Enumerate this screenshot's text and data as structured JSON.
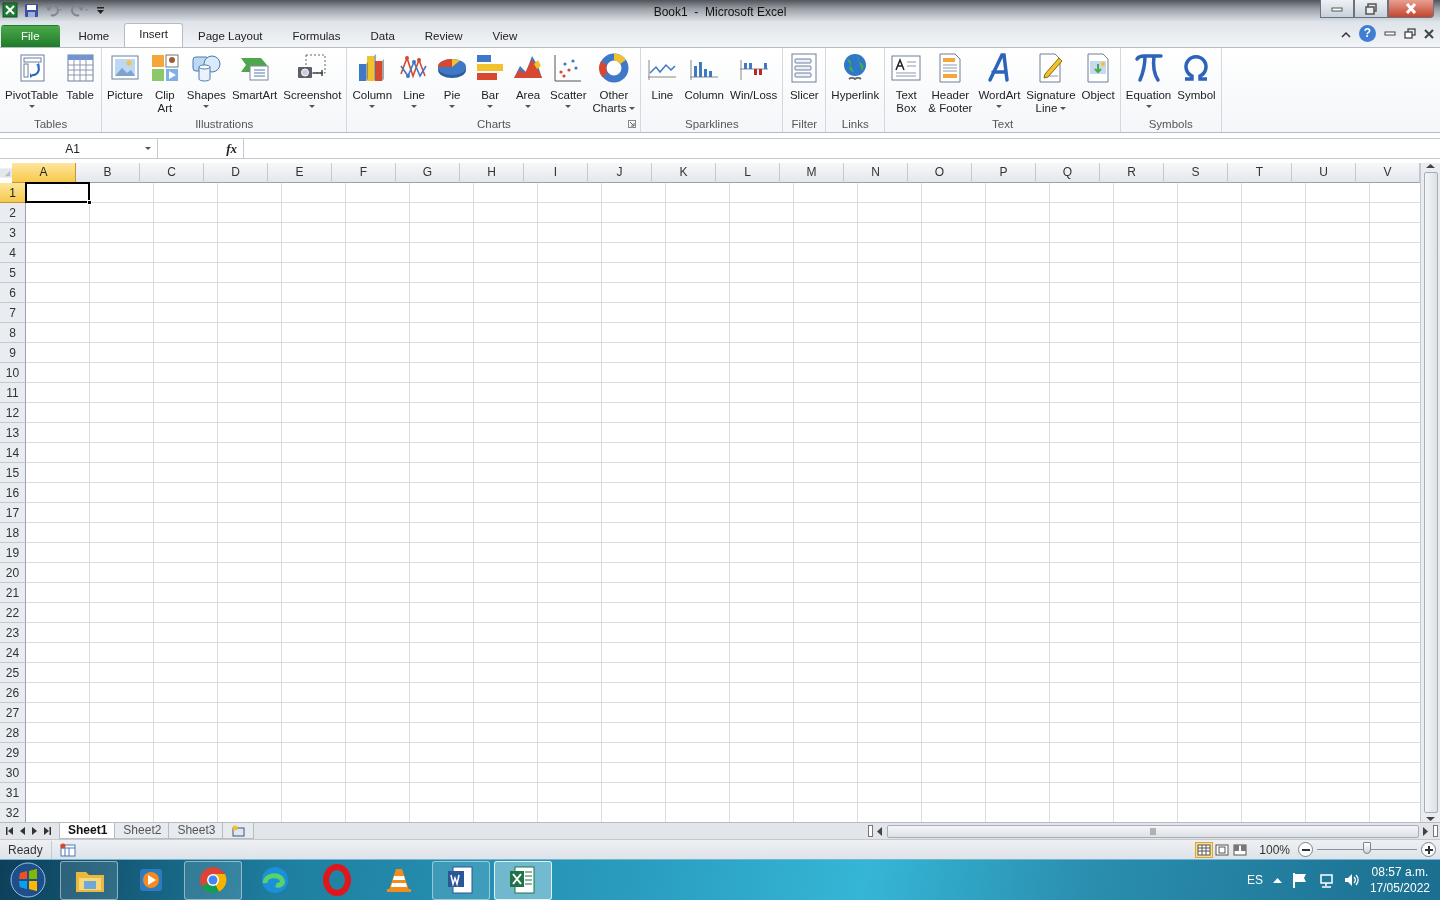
{
  "window": {
    "title": "Book1  -  Microsoft Excel"
  },
  "ribbon_tabs": [
    {
      "label": "File",
      "kind": "file",
      "selected": false
    },
    {
      "label": "Home",
      "kind": "tab",
      "selected": false
    },
    {
      "label": "Insert",
      "kind": "tab",
      "selected": true
    },
    {
      "label": "Page Layout",
      "kind": "tab",
      "selected": false
    },
    {
      "label": "Formulas",
      "kind": "tab",
      "selected": false
    },
    {
      "label": "Data",
      "kind": "tab",
      "selected": false
    },
    {
      "label": "Review",
      "kind": "tab",
      "selected": false
    },
    {
      "label": "View",
      "kind": "tab",
      "selected": false
    }
  ],
  "help": "?",
  "ribbon_groups": [
    {
      "label": "Tables",
      "buttons": [
        {
          "label": "PivotTable",
          "dropdown": true
        },
        {
          "label": "Table"
        }
      ]
    },
    {
      "label": "Illustrations",
      "buttons": [
        {
          "label": "Picture"
        },
        {
          "label": "Clip\nArt"
        },
        {
          "label": "Shapes",
          "dropdown": true
        },
        {
          "label": "SmartArt"
        },
        {
          "label": "Screenshot",
          "dropdown": true
        }
      ]
    },
    {
      "label": "Charts",
      "launcher": true,
      "buttons": [
        {
          "label": "Column",
          "dropdown": true
        },
        {
          "label": "Line",
          "dropdown": true
        },
        {
          "label": "Pie",
          "dropdown": true
        },
        {
          "label": "Bar",
          "dropdown": true
        },
        {
          "label": "Area",
          "dropdown": true
        },
        {
          "label": "Scatter",
          "dropdown": true
        },
        {
          "label": "Other\nCharts",
          "dropdown": true,
          "arrow_inline": true
        }
      ]
    },
    {
      "label": "Sparklines",
      "buttons": [
        {
          "label": "Line"
        },
        {
          "label": "Column"
        },
        {
          "label": "Win/Loss"
        }
      ]
    },
    {
      "label": "Filter",
      "buttons": [
        {
          "label": "Slicer"
        }
      ]
    },
    {
      "label": "Links",
      "buttons": [
        {
          "label": "Hyperlink"
        }
      ]
    },
    {
      "label": "Text",
      "buttons": [
        {
          "label": "Text\nBox"
        },
        {
          "label": "Header\n& Footer"
        },
        {
          "label": "WordArt",
          "dropdown": true
        },
        {
          "label": "Signature\nLine",
          "dropdown": true,
          "arrow_inline": true
        },
        {
          "label": "Object"
        }
      ]
    },
    {
      "label": "Symbols",
      "buttons": [
        {
          "label": "Equation",
          "dropdown": true
        },
        {
          "label": "Symbol"
        }
      ]
    }
  ],
  "formula_bar": {
    "name_box": "A1",
    "fx": "fx"
  },
  "columns": [
    {
      "label": "A",
      "selected": true
    },
    {
      "label": "B",
      "selected": false
    },
    {
      "label": "C",
      "selected": false
    },
    {
      "label": "D",
      "selected": false
    },
    {
      "label": "E",
      "selected": false
    },
    {
      "label": "F",
      "selected": false
    },
    {
      "label": "G",
      "selected": false
    },
    {
      "label": "H",
      "selected": false
    },
    {
      "label": "I",
      "selected": false
    },
    {
      "label": "J",
      "selected": false
    },
    {
      "label": "K",
      "selected": false
    },
    {
      "label": "L",
      "selected": false
    },
    {
      "label": "M",
      "selected": false
    },
    {
      "label": "N",
      "selected": false
    },
    {
      "label": "O",
      "selected": false
    },
    {
      "label": "P",
      "selected": false
    },
    {
      "label": "Q",
      "selected": false
    },
    {
      "label": "R",
      "selected": false
    },
    {
      "label": "S",
      "selected": false
    },
    {
      "label": "T",
      "selected": false
    },
    {
      "label": "U",
      "selected": false
    },
    {
      "label": "V",
      "selected": false
    }
  ],
  "rows": [
    {
      "label": "1",
      "selected": true
    },
    {
      "label": "2",
      "selected": false
    },
    {
      "label": "3",
      "selected": false
    },
    {
      "label": "4",
      "selected": false
    },
    {
      "label": "5",
      "selected": false
    },
    {
      "label": "6",
      "selected": false
    },
    {
      "label": "7",
      "selected": false
    },
    {
      "label": "8",
      "selected": false
    },
    {
      "label": "9",
      "selected": false
    },
    {
      "label": "10",
      "selected": false
    },
    {
      "label": "11",
      "selected": false
    },
    {
      "label": "12",
      "selected": false
    },
    {
      "label": "13",
      "selected": false
    },
    {
      "label": "14",
      "selected": false
    },
    {
      "label": "15",
      "selected": false
    },
    {
      "label": "16",
      "selected": false
    },
    {
      "label": "17",
      "selected": false
    },
    {
      "label": "18",
      "selected": false
    },
    {
      "label": "19",
      "selected": false
    },
    {
      "label": "20",
      "selected": false
    },
    {
      "label": "21",
      "selected": false
    },
    {
      "label": "22",
      "selected": false
    },
    {
      "label": "23",
      "selected": false
    },
    {
      "label": "24",
      "selected": false
    },
    {
      "label": "25",
      "selected": false
    },
    {
      "label": "26",
      "selected": false
    },
    {
      "label": "27",
      "selected": false
    },
    {
      "label": "28",
      "selected": false
    },
    {
      "label": "29",
      "selected": false
    },
    {
      "label": "30",
      "selected": false
    },
    {
      "label": "31",
      "selected": false
    },
    {
      "label": "32",
      "selected": false
    }
  ],
  "sheet_tabs": [
    {
      "label": "Sheet1",
      "selected": true
    },
    {
      "label": "Sheet2",
      "selected": false
    },
    {
      "label": "Sheet3",
      "selected": false
    }
  ],
  "status_bar": {
    "status": "Ready",
    "views": [
      {
        "selected": true
      },
      {
        "selected": false
      },
      {
        "selected": false
      }
    ],
    "zoom": "100%",
    "zoom_slider": {
      "level": 0.5
    }
  },
  "taskbar": {
    "apps": [
      {
        "running": true,
        "active": false
      },
      {
        "running": false,
        "active": false
      },
      {
        "running": true,
        "active": false
      },
      {
        "running": false,
        "active": false
      },
      {
        "running": false,
        "active": false
      },
      {
        "running": false,
        "active": false
      },
      {
        "running": true,
        "active": false
      },
      {
        "running": true,
        "active": true
      }
    ],
    "language": "ES",
    "time": "08:57 a.m.",
    "date": "17/05/2022"
  }
}
